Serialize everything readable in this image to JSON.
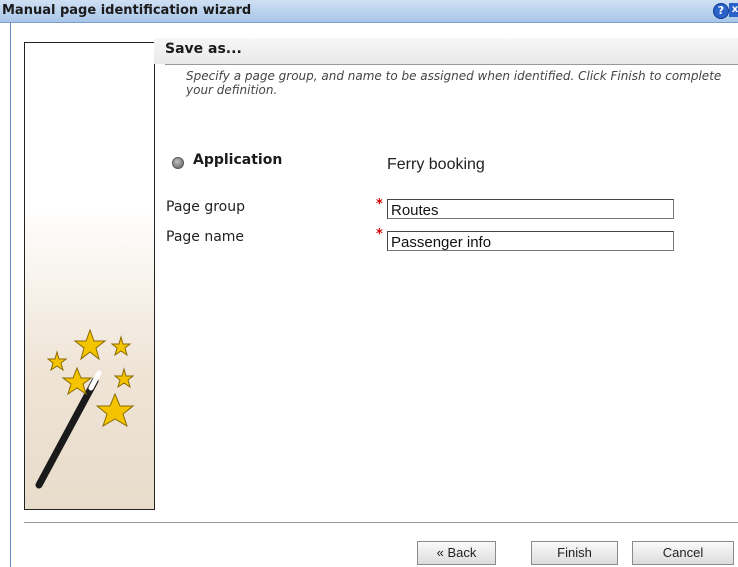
{
  "window": {
    "title": "Manual page identification wizard",
    "help_icon": "help-icon",
    "close_icon": "close-icon"
  },
  "step": {
    "title": "Save as...",
    "instructions": "Specify a page group, and name to be assigned when identified. Click Finish to complete your definition."
  },
  "application": {
    "label": "Application",
    "value": "Ferry booking"
  },
  "fields": [
    {
      "label": "Page group",
      "value": "Routes",
      "required_mark": "*"
    },
    {
      "label": "Page name",
      "value": "Passenger info",
      "required_mark": "*"
    }
  ],
  "buttons": {
    "back": "« Back",
    "finish": "Finish",
    "cancel": "Cancel"
  },
  "colors": {
    "accent": "#2a62c9",
    "title_bar": "#b9d1ee",
    "required": "#d40000",
    "star": "#f5c400"
  },
  "icons": {
    "wizard_image": "magic-wand-icon"
  }
}
